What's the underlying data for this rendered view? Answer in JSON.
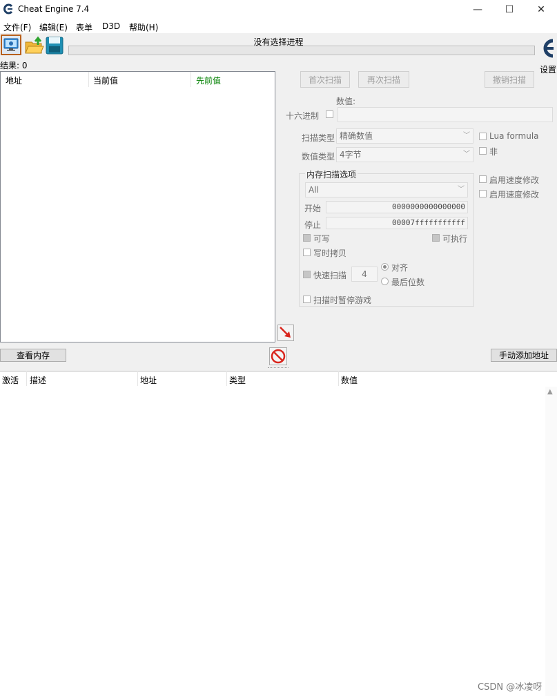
{
  "window": {
    "title": "Cheat Engine 7.4",
    "controls": {
      "minimize": "—",
      "maximize": "☐",
      "close": "✕"
    }
  },
  "menu": {
    "items": [
      "文件(F)",
      "编辑(E)",
      "表单",
      "D3D",
      "帮助(H)"
    ]
  },
  "toolbar": {
    "status": "没有选择进程",
    "settings_label": "设置",
    "results_label": "结果: 0"
  },
  "found_list": {
    "columns": [
      "地址",
      "当前值",
      "先前值"
    ],
    "colors": {
      "previous_value_header": "#008000"
    }
  },
  "scan_panel": {
    "first_scan": "首次扫描",
    "next_scan": "再次扫描",
    "undo_scan": "撤销扫描",
    "value_label": "数值:",
    "hex_label": "十六进制",
    "scan_type_label": "扫描类型",
    "scan_type_value": "精确数值",
    "value_type_label": "数值类型",
    "value_type_value": "4字节",
    "lua_formula": "Lua formula",
    "not_label": "非",
    "speedhack_1": "启用速度修改",
    "speedhack_2": "启用速度修改"
  },
  "memory_options": {
    "title": "内存扫描选项",
    "region": "All",
    "start_label": "开始",
    "start_value": "0000000000000000",
    "stop_label": "停止",
    "stop_value": "00007fffffffffff",
    "writable": "可写",
    "executable": "可执行",
    "copy_on_write": "写时拷贝",
    "fast_scan": "快速扫描",
    "fast_scan_value": "4",
    "align": "对齐",
    "last_digits": "最后位数",
    "pause_game": "扫描时暂停游戏"
  },
  "bottom_bar": {
    "view_memory": "查看内存",
    "add_address": "手动添加地址"
  },
  "address_list": {
    "columns": [
      "激活",
      "描述",
      "地址",
      "类型",
      "数值"
    ]
  },
  "watermark": "CSDN @冰凌呀"
}
